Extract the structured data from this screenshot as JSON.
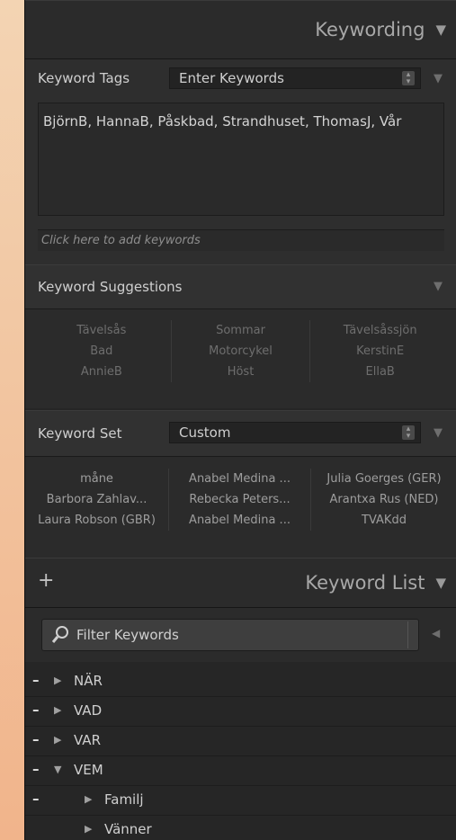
{
  "keywording": {
    "title": "Keywording",
    "collapse_icon": "triangle-down-icon",
    "tags_label": "Keyword Tags",
    "tags_mode": "Enter Keywords",
    "tags_text": "BjörnB, HannaB, Påskbad, Strandhuset, ThomasJ, Vår",
    "add_placeholder": "Click here to add keywords"
  },
  "suggestions": {
    "label": "Keyword Suggestions",
    "rows": [
      [
        "Tävelsås",
        "Sommar",
        "Tävelsåssjön"
      ],
      [
        "Bad",
        "Motorcykel",
        "KerstinE"
      ],
      [
        "AnnieB",
        "Höst",
        "EllaB"
      ]
    ]
  },
  "keyword_set": {
    "label": "Keyword Set",
    "value": "Custom",
    "rows": [
      [
        "måne",
        "Anabel Medina ...",
        "Julia Goerges (GER)"
      ],
      [
        "Barbora Zahlav...",
        "Rebecka Peters...",
        "Arantxa Rus (NED)"
      ],
      [
        "Laura Robson (GBR)",
        "Anabel Medina ...",
        "TVAKdd"
      ]
    ]
  },
  "keyword_list": {
    "title": "Keyword List",
    "add_symbol": "+",
    "filter_placeholder": "Filter Keywords",
    "items": [
      {
        "name": "NÄR",
        "expanded": false
      },
      {
        "name": "VAD",
        "expanded": false
      },
      {
        "name": "VAR",
        "expanded": false
      },
      {
        "name": "VEM",
        "expanded": true
      }
    ],
    "children": [
      {
        "name": "Familj"
      },
      {
        "name": "Vänner"
      }
    ]
  }
}
